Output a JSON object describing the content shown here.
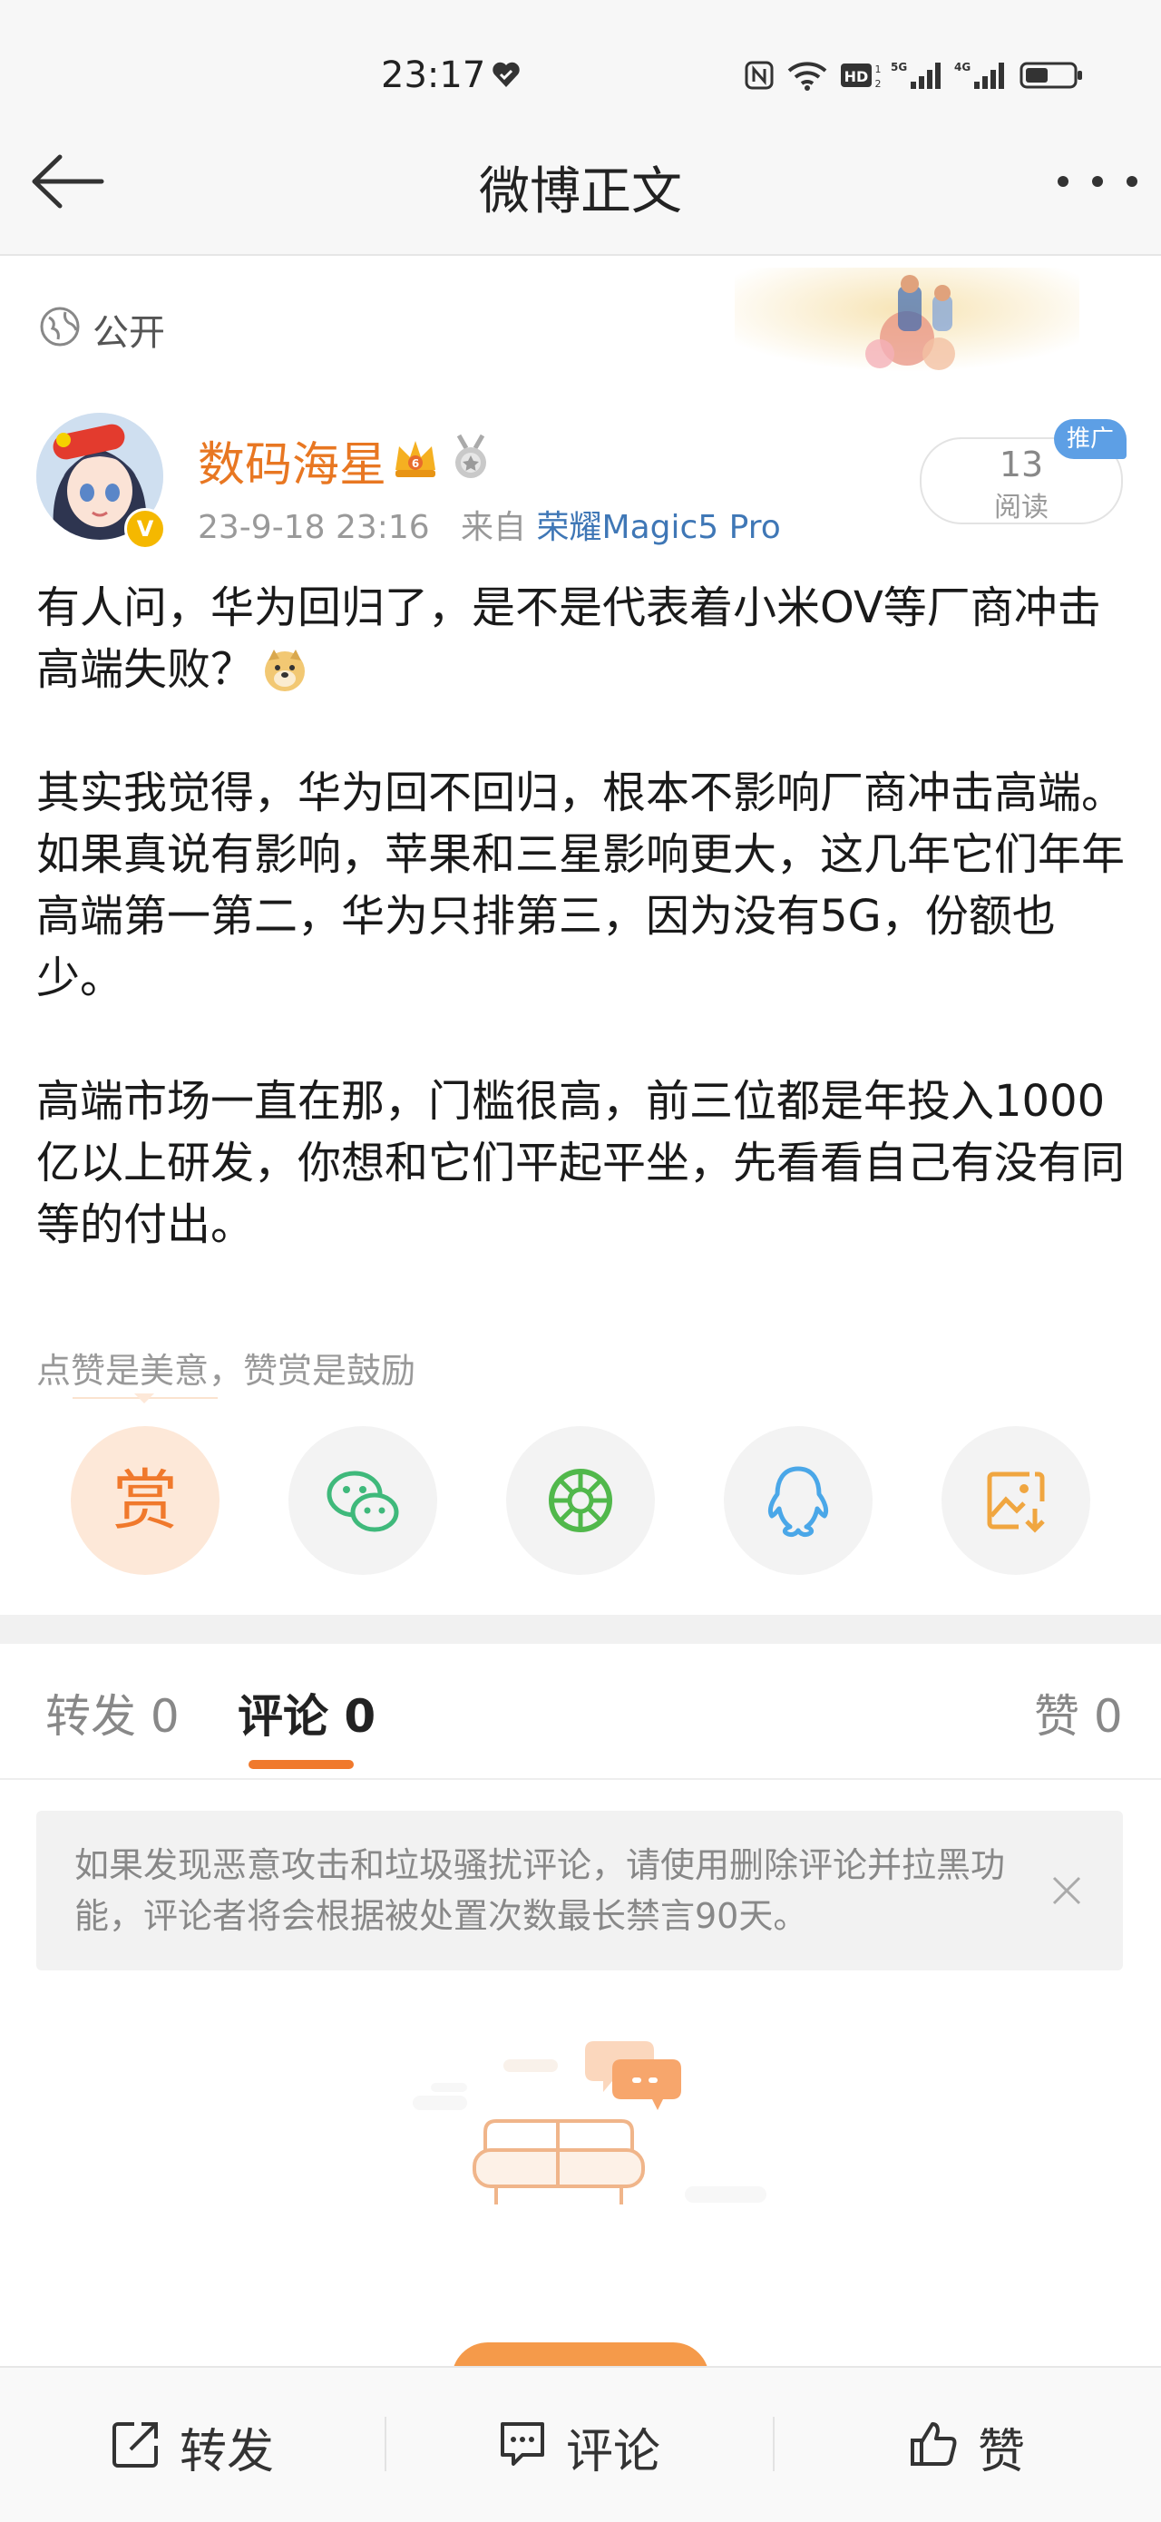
{
  "status_bar": {
    "time": "23:17",
    "icons": [
      "heart-badge-icon",
      "nfc-icon",
      "wifi-icon",
      "hd-icon",
      "signal-5g-icon",
      "signal-4g-icon",
      "battery-icon"
    ]
  },
  "nav": {
    "title": "微博正文",
    "back_icon": "back-arrow-icon",
    "more_icon": "more-dots-icon"
  },
  "visibility": {
    "label": "公开",
    "icon": "globe-icon"
  },
  "author": {
    "name": "数码海星",
    "verified": "V",
    "timestamp": "23-9-18 23:16",
    "source_prefix": "来自",
    "device": "荣耀Magic5 Pro"
  },
  "read_box": {
    "count": "13",
    "label": "阅读",
    "ad_badge": "推广"
  },
  "post": {
    "paragraphs": [
      "有人问，华为回归了，是不是代表着小米OV等厂商冲击高端失败？",
      "其实我觉得，华为回不回归，根本不影响厂商冲击高端。如果真说有影响，苹果和三星影响更大，这几年它们年年高端第一第二，华为只排第三，因为没有5G，份额也少。",
      "高端市场一直在那，门槛很高，前三位都是年投入1000亿以上研发，你想和它们平起平坐，先看看自己有没有同等的付出。"
    ],
    "emoji_icon": "doge-emoji-icon"
  },
  "reward": {
    "hint": "点赞是美意，赞赏是鼓励",
    "reward_label": "赏",
    "share_icons": [
      "wechat-icon",
      "moments-icon",
      "qq-icon",
      "save-image-icon"
    ]
  },
  "tabs": {
    "repost": "转发 0",
    "comment": "评论 0",
    "like": "赞 0",
    "active": "comment"
  },
  "notice": {
    "text": "如果发现恶意攻击和垃圾骚扰评论，请使用删除评论并拉黑功能，评论者将会根据被处置次数最长禁言90天。"
  },
  "bottom_bar": {
    "repost": "转发",
    "comment": "评论",
    "like": "赞"
  },
  "colors": {
    "accent": "#f0792c",
    "author_name": "#e87722",
    "device_link": "#3f77b6",
    "ad_badge": "#5d9fe5"
  }
}
